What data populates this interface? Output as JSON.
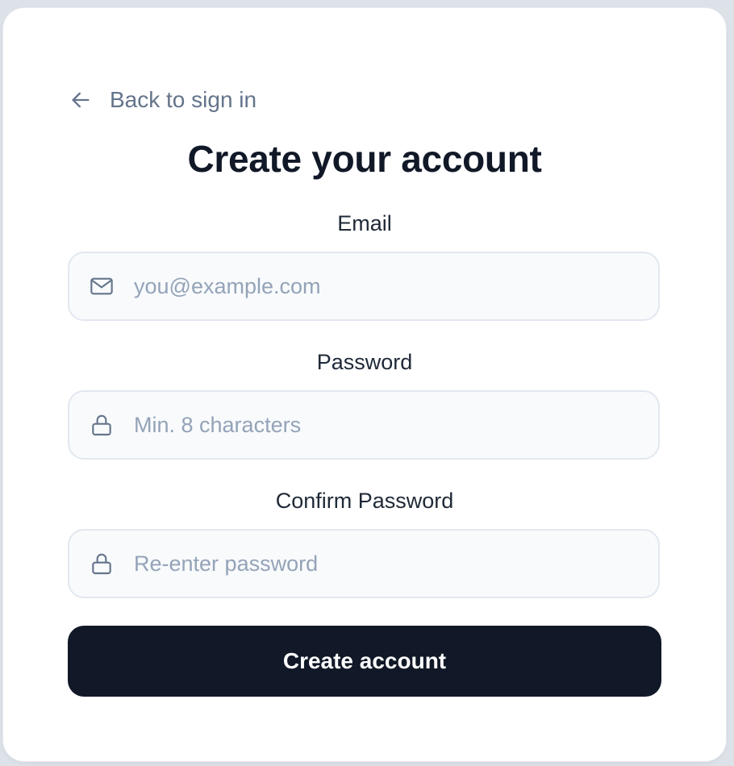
{
  "back_link": {
    "label": "Back to sign in",
    "icon": "arrow-left-icon"
  },
  "title": "Create your account",
  "fields": {
    "email": {
      "label": "Email",
      "placeholder": "you@example.com",
      "value": "",
      "icon": "mail-icon"
    },
    "password": {
      "label": "Password",
      "placeholder": "Min. 8 characters",
      "value": "",
      "icon": "lock-icon"
    },
    "confirm_password": {
      "label": "Confirm Password",
      "placeholder": "Re-enter password",
      "value": "",
      "icon": "lock-icon"
    }
  },
  "submit": {
    "label": "Create account"
  },
  "colors": {
    "primary": "#111827",
    "muted_text": "#64748b",
    "placeholder": "#94a3b8",
    "input_bg": "#f8fafc",
    "input_border": "#e2e8f0"
  }
}
